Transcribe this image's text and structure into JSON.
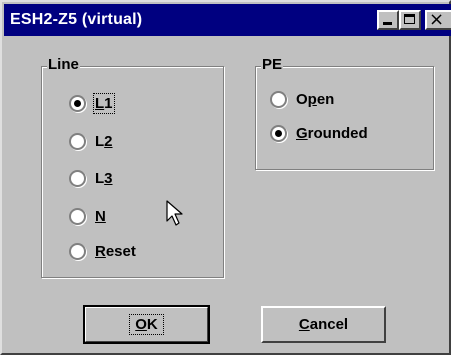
{
  "window": {
    "title": "ESH2-Z5 (virtual)"
  },
  "line_group": {
    "label": "Line",
    "options": [
      {
        "pre": "",
        "key": "L",
        "post": "1",
        "checked": true
      },
      {
        "pre": "L",
        "key": "2",
        "post": "",
        "checked": false
      },
      {
        "pre": "L",
        "key": "3",
        "post": "",
        "checked": false
      },
      {
        "pre": "",
        "key": "N",
        "post": "",
        "checked": false
      },
      {
        "pre": "",
        "key": "R",
        "post": "eset",
        "checked": false
      }
    ]
  },
  "pe_group": {
    "label": "PE",
    "options": [
      {
        "pre": "O",
        "key": "p",
        "post": "en",
        "checked": false
      },
      {
        "pre": "",
        "key": "G",
        "post": "rounded",
        "checked": true
      }
    ]
  },
  "buttons": {
    "ok": {
      "key": "O",
      "post": "K"
    },
    "cancel": {
      "key": "C",
      "post": "ancel"
    }
  },
  "icons": [
    "minimize-icon",
    "maximize-icon",
    "close-icon",
    "mouse-pointer-icon"
  ],
  "colors": {
    "titlebar": "#000080",
    "face": "#c0c0c0"
  }
}
